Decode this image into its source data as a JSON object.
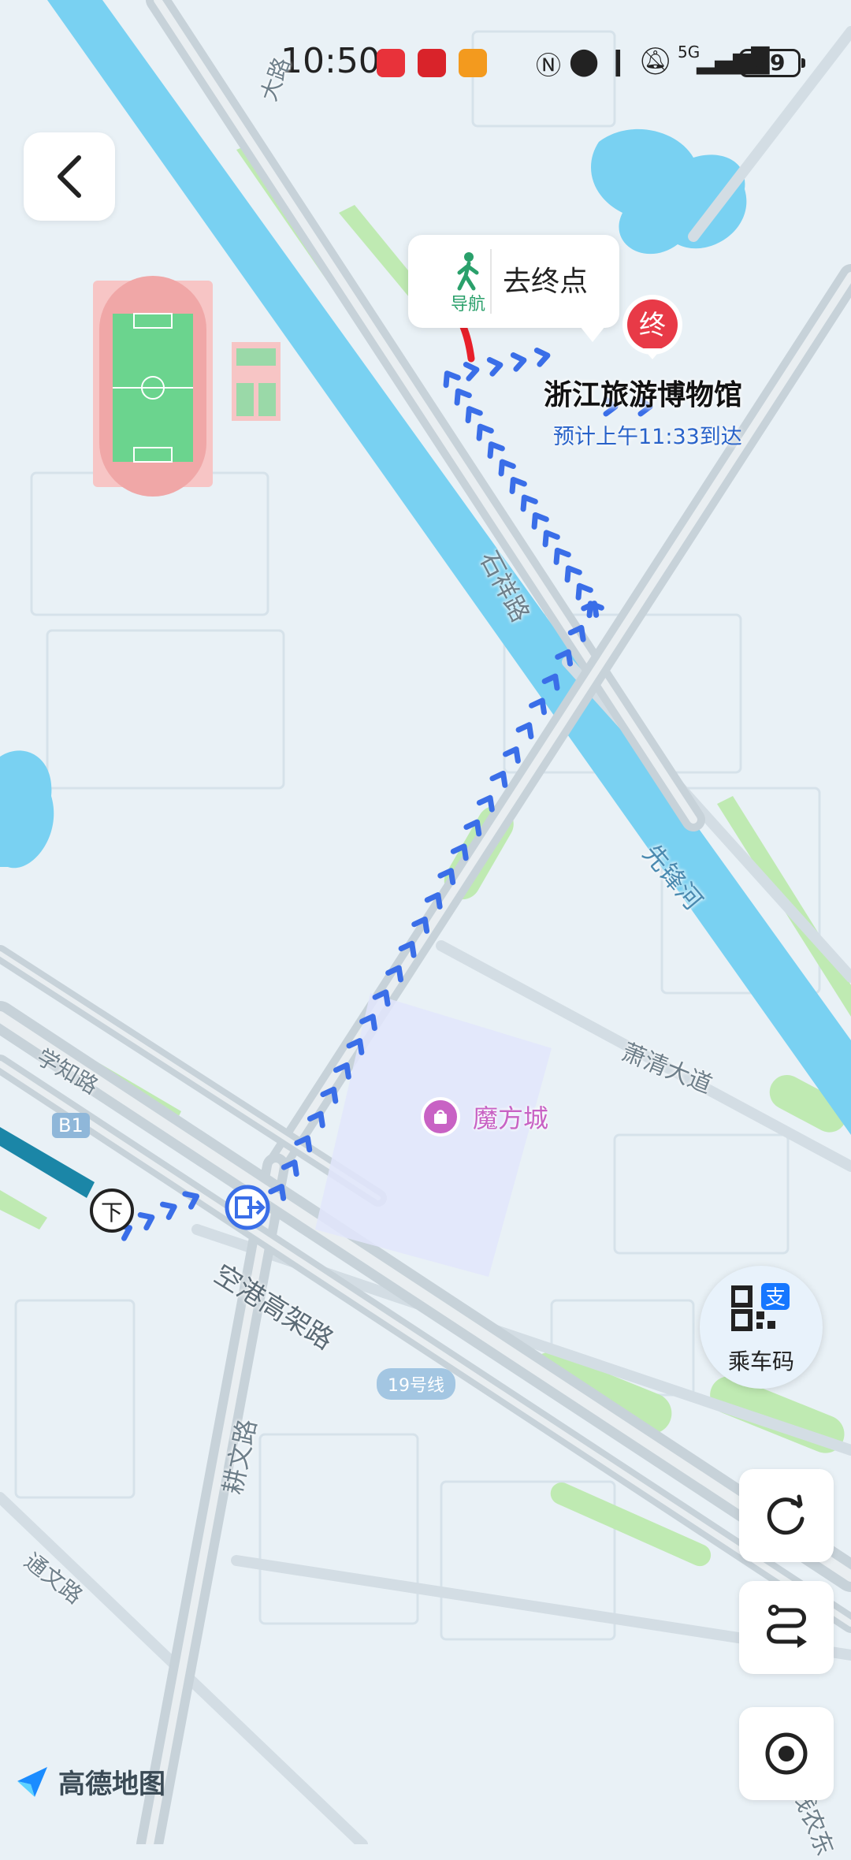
{
  "status_bar": {
    "time": "10:50",
    "network": "5G",
    "battery": "59"
  },
  "navigation": {
    "back_label": "",
    "walk_nav_label": "导航",
    "go_destination_label": "去终点",
    "end_marker_label": "终"
  },
  "destination": {
    "name": "浙江旅游博物馆",
    "eta": "预计上午11:33到达"
  },
  "map_labels": {
    "road_shizhuan": "石祥路",
    "river_xianfeng": "先锋河",
    "xiaoqing_avenue": "萧清大道",
    "xuezhi_road": "学知路",
    "konggang_elevated": "空港高架路",
    "gengwen_road": "耕文路",
    "tongwen_road": "通文路",
    "top_road": "大路",
    "poi_mofangcheng": "魔方城",
    "exit_badge": "B1",
    "metro_line": "19号线",
    "get_off_marker": "下",
    "bottom_right_road": "钱农东"
  },
  "controls": {
    "ride_code_label": "乘车码",
    "refresh_icon": "refresh-icon",
    "route_icon": "route-icon",
    "locate_icon": "locate-icon"
  },
  "brand": {
    "name": "高德地图"
  },
  "colors": {
    "route_blue": "#3a6ee8",
    "walk_red": "#e8202a",
    "water": "#79d1f2",
    "green": "#bfeab2",
    "end_marker": "#e83a47",
    "poi_purple": "#c862c4",
    "eta_blue": "#2862c9"
  }
}
